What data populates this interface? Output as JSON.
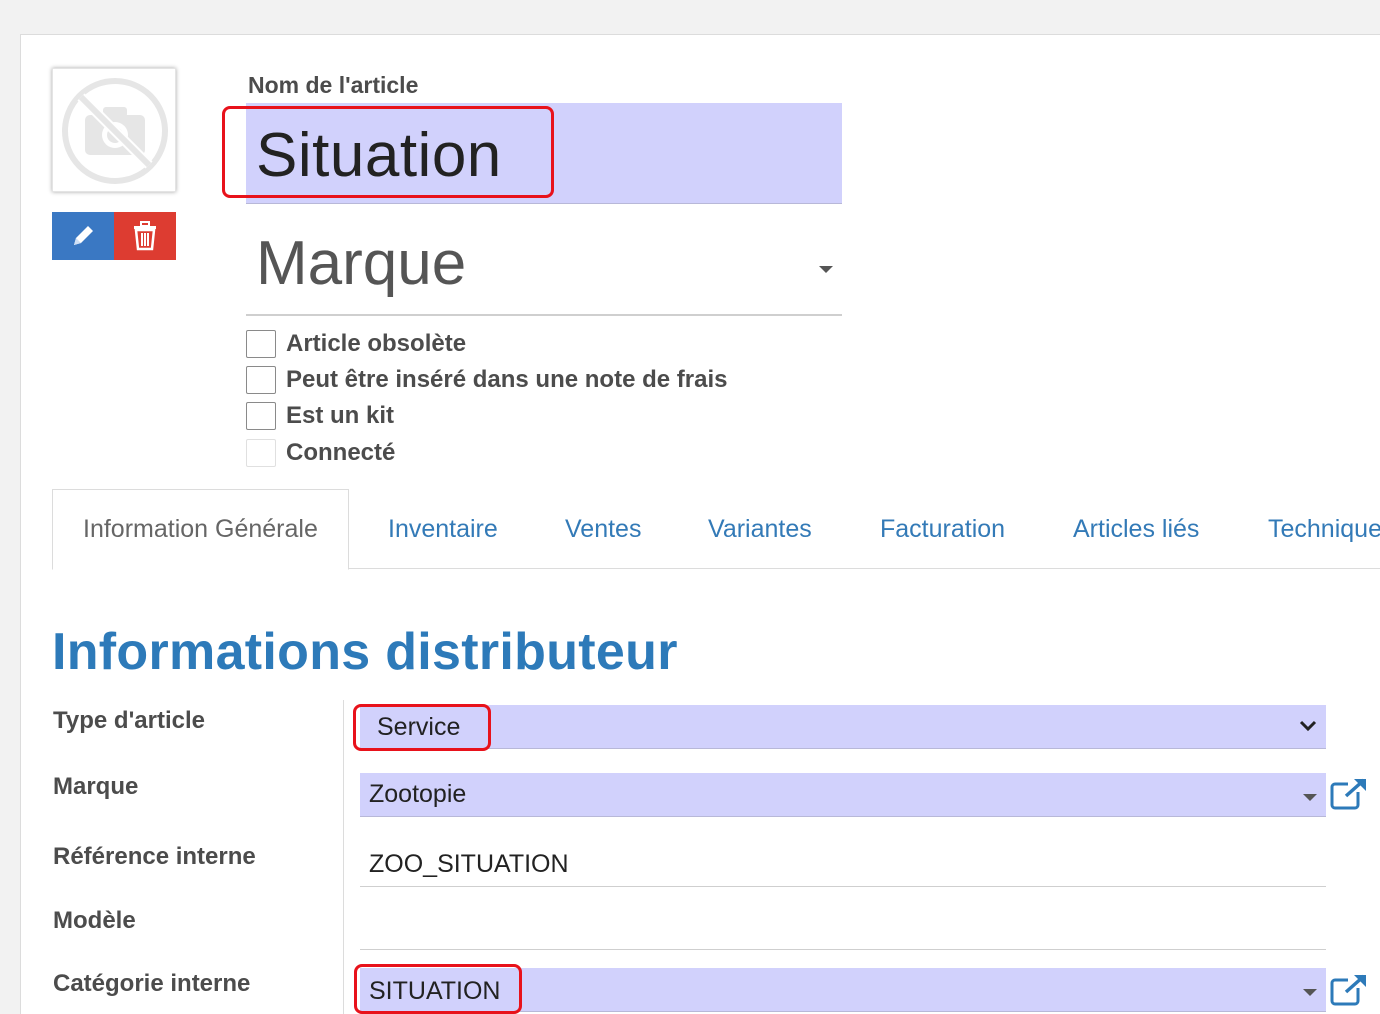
{
  "header": {
    "name_label": "Nom de l'article",
    "name_value": "Situation",
    "brand_placeholder": "Marque"
  },
  "checkboxes": [
    {
      "label": "Article obsolète",
      "checked": false
    },
    {
      "label": "Peut être inséré dans une note de frais",
      "checked": false
    },
    {
      "label": "Est un kit",
      "checked": false
    },
    {
      "label": "Connecté",
      "checked": false
    }
  ],
  "tabs": [
    {
      "label": "Information Générale",
      "active": true
    },
    {
      "label": "Inventaire"
    },
    {
      "label": "Ventes"
    },
    {
      "label": "Variantes"
    },
    {
      "label": "Facturation"
    },
    {
      "label": "Articles liés"
    },
    {
      "label": "Technique"
    }
  ],
  "section": {
    "title": "Informations distributeur",
    "fields": [
      {
        "label": "Type d'article",
        "value": "Service"
      },
      {
        "label": "Marque",
        "value": "Zootopie"
      },
      {
        "label": "Référence interne",
        "value": "ZOO_SITUATION"
      },
      {
        "label": "Modèle",
        "value": ""
      },
      {
        "label": "Catégorie interne",
        "value": "SITUATION"
      }
    ]
  },
  "colors": {
    "highlight": "#d1d1fc",
    "link": "#337ab7",
    "section_title": "#2d7ab9",
    "edit_button": "#3a78c3",
    "delete_button": "#dd3c31",
    "annotation_box": "#e8121b"
  },
  "icons": [
    "no-image-camera-icon",
    "pencil-icon",
    "trash-icon",
    "caret-down-icon",
    "chevron-down-icon",
    "external-link-icon"
  ]
}
